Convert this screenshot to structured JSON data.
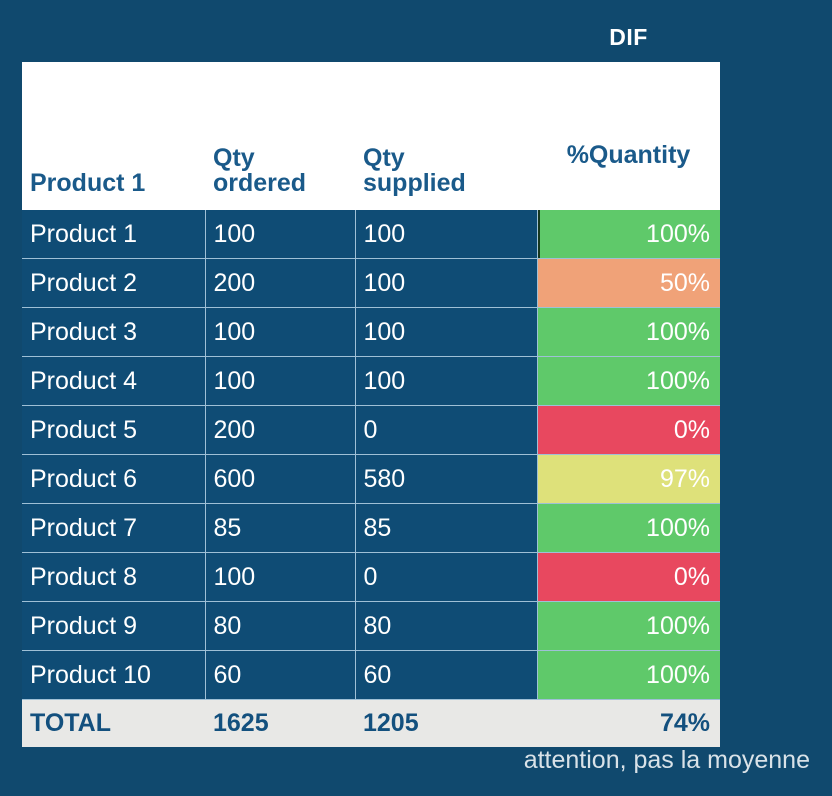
{
  "labels": {
    "dif": "DIF",
    "footnote": "attention, pas la moyenne"
  },
  "table": {
    "headers": {
      "name": "Product 1",
      "ordered": "Qty\nordered",
      "supplied": "Qty\nsupplied",
      "percent": "%Quantity"
    },
    "rows": [
      {
        "name": "Product 1",
        "ordered": "100",
        "supplied": "100",
        "percent": "100%",
        "fill": "#5FC96A"
      },
      {
        "name": "Product 2",
        "ordered": "200",
        "supplied": "100",
        "percent": "50%",
        "fill": "#F0A278"
      },
      {
        "name": "Product 3",
        "ordered": "100",
        "supplied": "100",
        "percent": "100%",
        "fill": "#5FC96A"
      },
      {
        "name": "Product 4",
        "ordered": "100",
        "supplied": "100",
        "percent": "100%",
        "fill": "#5FC96A"
      },
      {
        "name": "Product 5",
        "ordered": "200",
        "supplied": "0",
        "percent": "0%",
        "fill": "#E8485F"
      },
      {
        "name": "Product 6",
        "ordered": "600",
        "supplied": "580",
        "percent": "97%",
        "fill": "#DEE17A"
      },
      {
        "name": "Product 7",
        "ordered": "85",
        "supplied": "85",
        "percent": "100%",
        "fill": "#5FC96A"
      },
      {
        "name": "Product 8",
        "ordered": "100",
        "supplied": "0",
        "percent": "0%",
        "fill": "#E8485F"
      },
      {
        "name": "Product 9",
        "ordered": "80",
        "supplied": "80",
        "percent": "100%",
        "fill": "#5FC96A"
      },
      {
        "name": "Product 10",
        "ordered": "60",
        "supplied": "60",
        "percent": "100%",
        "fill": "#5FC96A"
      }
    ],
    "total": {
      "name": "TOTAL",
      "ordered": "1625",
      "supplied": "1205",
      "percent": "74%"
    }
  },
  "colors": {
    "background": "#10496E",
    "cell_blue": "#0F4C75",
    "header_text": "#1A5A8A",
    "gridline": "#9FC0D6",
    "total_row": "#E8E8E6",
    "green": "#5FC96A",
    "yellow_green": "#DEE17A",
    "orange": "#F0A278",
    "red": "#E8485F",
    "active_cell_border": "#17381F"
  },
  "chart_data": {
    "type": "table",
    "title": "DIF",
    "categories": [
      "Product 1",
      "Product 2",
      "Product 3",
      "Product 4",
      "Product 5",
      "Product 6",
      "Product 7",
      "Product 8",
      "Product 9",
      "Product 10"
    ],
    "series": [
      {
        "name": "Qty ordered",
        "values": [
          100,
          200,
          100,
          100,
          200,
          600,
          85,
          100,
          80,
          60
        ]
      },
      {
        "name": "Qty supplied",
        "values": [
          100,
          100,
          100,
          100,
          0,
          580,
          85,
          0,
          80,
          60
        ]
      },
      {
        "name": "%Quantity",
        "values": [
          100,
          50,
          100,
          100,
          0,
          97,
          100,
          0,
          100,
          100
        ]
      }
    ],
    "totals": {
      "Qty ordered": 1625,
      "Qty supplied": 1205,
      "%Quantity": 74
    },
    "annotations": [
      "attention, pas la moyenne"
    ]
  }
}
